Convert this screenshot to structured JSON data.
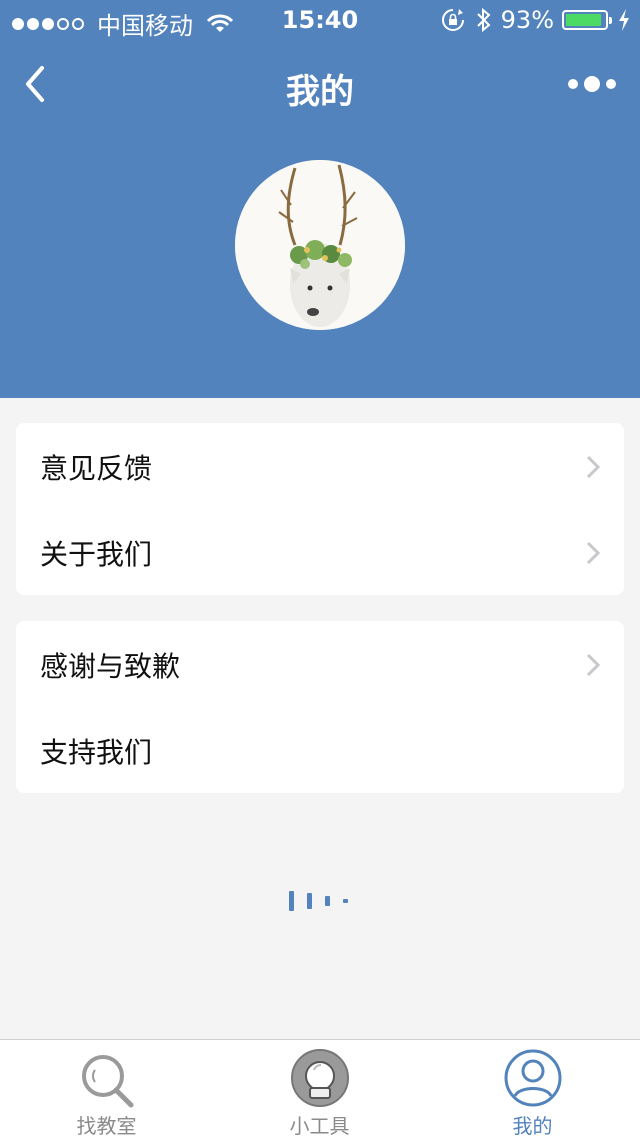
{
  "status_bar": {
    "carrier": "中国移动",
    "time": "15:40",
    "battery": "93%",
    "battery_level": 0.93
  },
  "nav": {
    "title": "我的"
  },
  "menu": {
    "group1": [
      {
        "label": "意见反馈",
        "has_chevron": true
      },
      {
        "label": "关于我们",
        "has_chevron": true
      }
    ],
    "group2": [
      {
        "label": "感谢与致歉",
        "has_chevron": true
      },
      {
        "label": "支持我们",
        "has_chevron": false
      }
    ]
  },
  "tabbar": {
    "tabs": [
      {
        "label": "找教室",
        "icon": "search-icon",
        "active": false
      },
      {
        "label": "小工具",
        "icon": "tools-icon",
        "active": false
      },
      {
        "label": "我的",
        "icon": "user-icon",
        "active": true
      }
    ]
  },
  "colors": {
    "primary": "#5383bc",
    "battery": "#4cd964",
    "tab_inactive": "#8a8a8a"
  }
}
